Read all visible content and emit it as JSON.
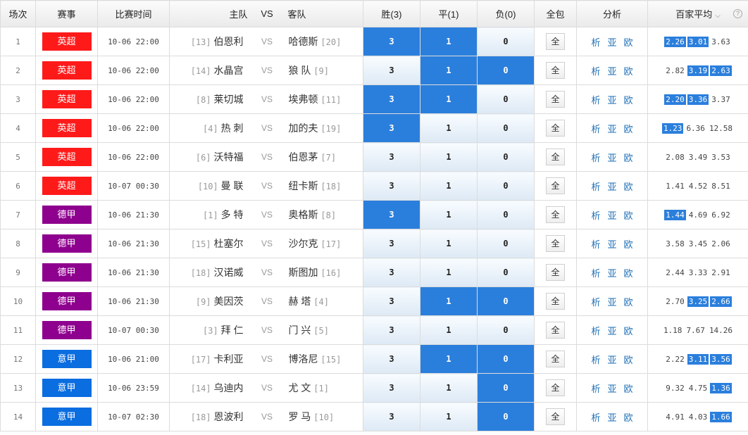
{
  "headers": {
    "num": "场次",
    "league": "赛事",
    "time": "比赛时间",
    "home": "主队",
    "vs": "VS",
    "away": "客队",
    "win": "胜(3)",
    "draw": "平(1)",
    "lose": "负(0)",
    "all": "全包",
    "analysis": "分析",
    "avg": "百家平均"
  },
  "colors": {
    "英超": "#ff1a1a",
    "德甲": "#8e008e",
    "意甲": "#0a6de0",
    "selected": "#2b7fdc"
  },
  "analysis_links": [
    "析",
    "亚",
    "欧"
  ],
  "all_label": "全",
  "vs_label": "VS",
  "icons": {
    "sort": "chevron-down-icon",
    "help": "question-circle-icon"
  },
  "matches": [
    {
      "num": "1",
      "league": "英超",
      "time": "10-06 22:00",
      "home_rank": "[13]",
      "home": "伯恩利",
      "away": "哈德斯",
      "away_rank": "[20]",
      "win": "3",
      "draw": "1",
      "lose": "0",
      "sel": [
        1,
        1,
        0
      ],
      "odds": [
        "2.26",
        "3.01",
        "3.63"
      ],
      "hl": [
        1,
        1,
        0
      ]
    },
    {
      "num": "2",
      "league": "英超",
      "time": "10-06 22:00",
      "home_rank": "[14]",
      "home": "水晶宫",
      "away": "狼 队",
      "away_rank": "[9]",
      "win": "3",
      "draw": "1",
      "lose": "0",
      "sel": [
        0,
        1,
        1
      ],
      "odds": [
        "2.82",
        "3.19",
        "2.63"
      ],
      "hl": [
        0,
        1,
        1
      ]
    },
    {
      "num": "3",
      "league": "英超",
      "time": "10-06 22:00",
      "home_rank": "[8]",
      "home": "莱切城",
      "away": "埃弗顿",
      "away_rank": "[11]",
      "win": "3",
      "draw": "1",
      "lose": "0",
      "sel": [
        1,
        1,
        0
      ],
      "odds": [
        "2.20",
        "3.36",
        "3.37"
      ],
      "hl": [
        1,
        1,
        0
      ]
    },
    {
      "num": "4",
      "league": "英超",
      "time": "10-06 22:00",
      "home_rank": "[4]",
      "home": "热 刺",
      "away": "加的夫",
      "away_rank": "[19]",
      "win": "3",
      "draw": "1",
      "lose": "0",
      "sel": [
        1,
        0,
        0
      ],
      "odds": [
        "1.23",
        "6.36",
        "12.58"
      ],
      "hl": [
        1,
        0,
        0
      ]
    },
    {
      "num": "5",
      "league": "英超",
      "time": "10-06 22:00",
      "home_rank": "[6]",
      "home": "沃特福",
      "away": "伯恩茅",
      "away_rank": "[7]",
      "win": "3",
      "draw": "1",
      "lose": "0",
      "sel": [
        0,
        0,
        0
      ],
      "odds": [
        "2.08",
        "3.49",
        "3.53"
      ],
      "hl": [
        0,
        0,
        0
      ]
    },
    {
      "num": "6",
      "league": "英超",
      "time": "10-07 00:30",
      "home_rank": "[10]",
      "home": "曼 联",
      "away": "纽卡斯",
      "away_rank": "[18]",
      "win": "3",
      "draw": "1",
      "lose": "0",
      "sel": [
        0,
        0,
        0
      ],
      "odds": [
        "1.41",
        "4.52",
        "8.51"
      ],
      "hl": [
        0,
        0,
        0
      ]
    },
    {
      "num": "7",
      "league": "德甲",
      "time": "10-06 21:30",
      "home_rank": "[1]",
      "home": "多 特",
      "away": "奥格斯",
      "away_rank": "[8]",
      "win": "3",
      "draw": "1",
      "lose": "0",
      "sel": [
        1,
        0,
        0
      ],
      "odds": [
        "1.44",
        "4.69",
        "6.92"
      ],
      "hl": [
        1,
        0,
        0
      ]
    },
    {
      "num": "8",
      "league": "德甲",
      "time": "10-06 21:30",
      "home_rank": "[15]",
      "home": "杜塞尔",
      "away": "沙尔克",
      "away_rank": "[17]",
      "win": "3",
      "draw": "1",
      "lose": "0",
      "sel": [
        0,
        0,
        0
      ],
      "odds": [
        "3.58",
        "3.45",
        "2.06"
      ],
      "hl": [
        0,
        0,
        0
      ]
    },
    {
      "num": "9",
      "league": "德甲",
      "time": "10-06 21:30",
      "home_rank": "[18]",
      "home": "汉诺威",
      "away": "斯图加",
      "away_rank": "[16]",
      "win": "3",
      "draw": "1",
      "lose": "0",
      "sel": [
        0,
        0,
        0
      ],
      "odds": [
        "2.44",
        "3.33",
        "2.91"
      ],
      "hl": [
        0,
        0,
        0
      ]
    },
    {
      "num": "10",
      "league": "德甲",
      "time": "10-06 21:30",
      "home_rank": "[9]",
      "home": "美因茨",
      "away": "赫 塔",
      "away_rank": "[4]",
      "win": "3",
      "draw": "1",
      "lose": "0",
      "sel": [
        0,
        1,
        1
      ],
      "odds": [
        "2.70",
        "3.25",
        "2.66"
      ],
      "hl": [
        0,
        1,
        1
      ]
    },
    {
      "num": "11",
      "league": "德甲",
      "time": "10-07 00:30",
      "home_rank": "[3]",
      "home": "拜 仁",
      "away": "门 兴",
      "away_rank": "[5]",
      "win": "3",
      "draw": "1",
      "lose": "0",
      "sel": [
        0,
        0,
        0
      ],
      "odds": [
        "1.18",
        "7.67",
        "14.26"
      ],
      "hl": [
        0,
        0,
        0
      ]
    },
    {
      "num": "12",
      "league": "意甲",
      "time": "10-06 21:00",
      "home_rank": "[17]",
      "home": "卡利亚",
      "away": "博洛尼",
      "away_rank": "[15]",
      "win": "3",
      "draw": "1",
      "lose": "0",
      "sel": [
        0,
        1,
        1
      ],
      "odds": [
        "2.22",
        "3.11",
        "3.56"
      ],
      "hl": [
        0,
        1,
        1
      ]
    },
    {
      "num": "13",
      "league": "意甲",
      "time": "10-06 23:59",
      "home_rank": "[14]",
      "home": "乌迪内",
      "away": "尤 文",
      "away_rank": "[1]",
      "win": "3",
      "draw": "1",
      "lose": "0",
      "sel": [
        0,
        0,
        1
      ],
      "odds": [
        "9.32",
        "4.75",
        "1.36"
      ],
      "hl": [
        0,
        0,
        1
      ]
    },
    {
      "num": "14",
      "league": "意甲",
      "time": "10-07 02:30",
      "home_rank": "[18]",
      "home": "恩波利",
      "away": "罗 马",
      "away_rank": "[10]",
      "win": "3",
      "draw": "1",
      "lose": "0",
      "sel": [
        0,
        0,
        1
      ],
      "odds": [
        "4.91",
        "4.03",
        "1.66"
      ],
      "hl": [
        0,
        0,
        1
      ]
    }
  ]
}
